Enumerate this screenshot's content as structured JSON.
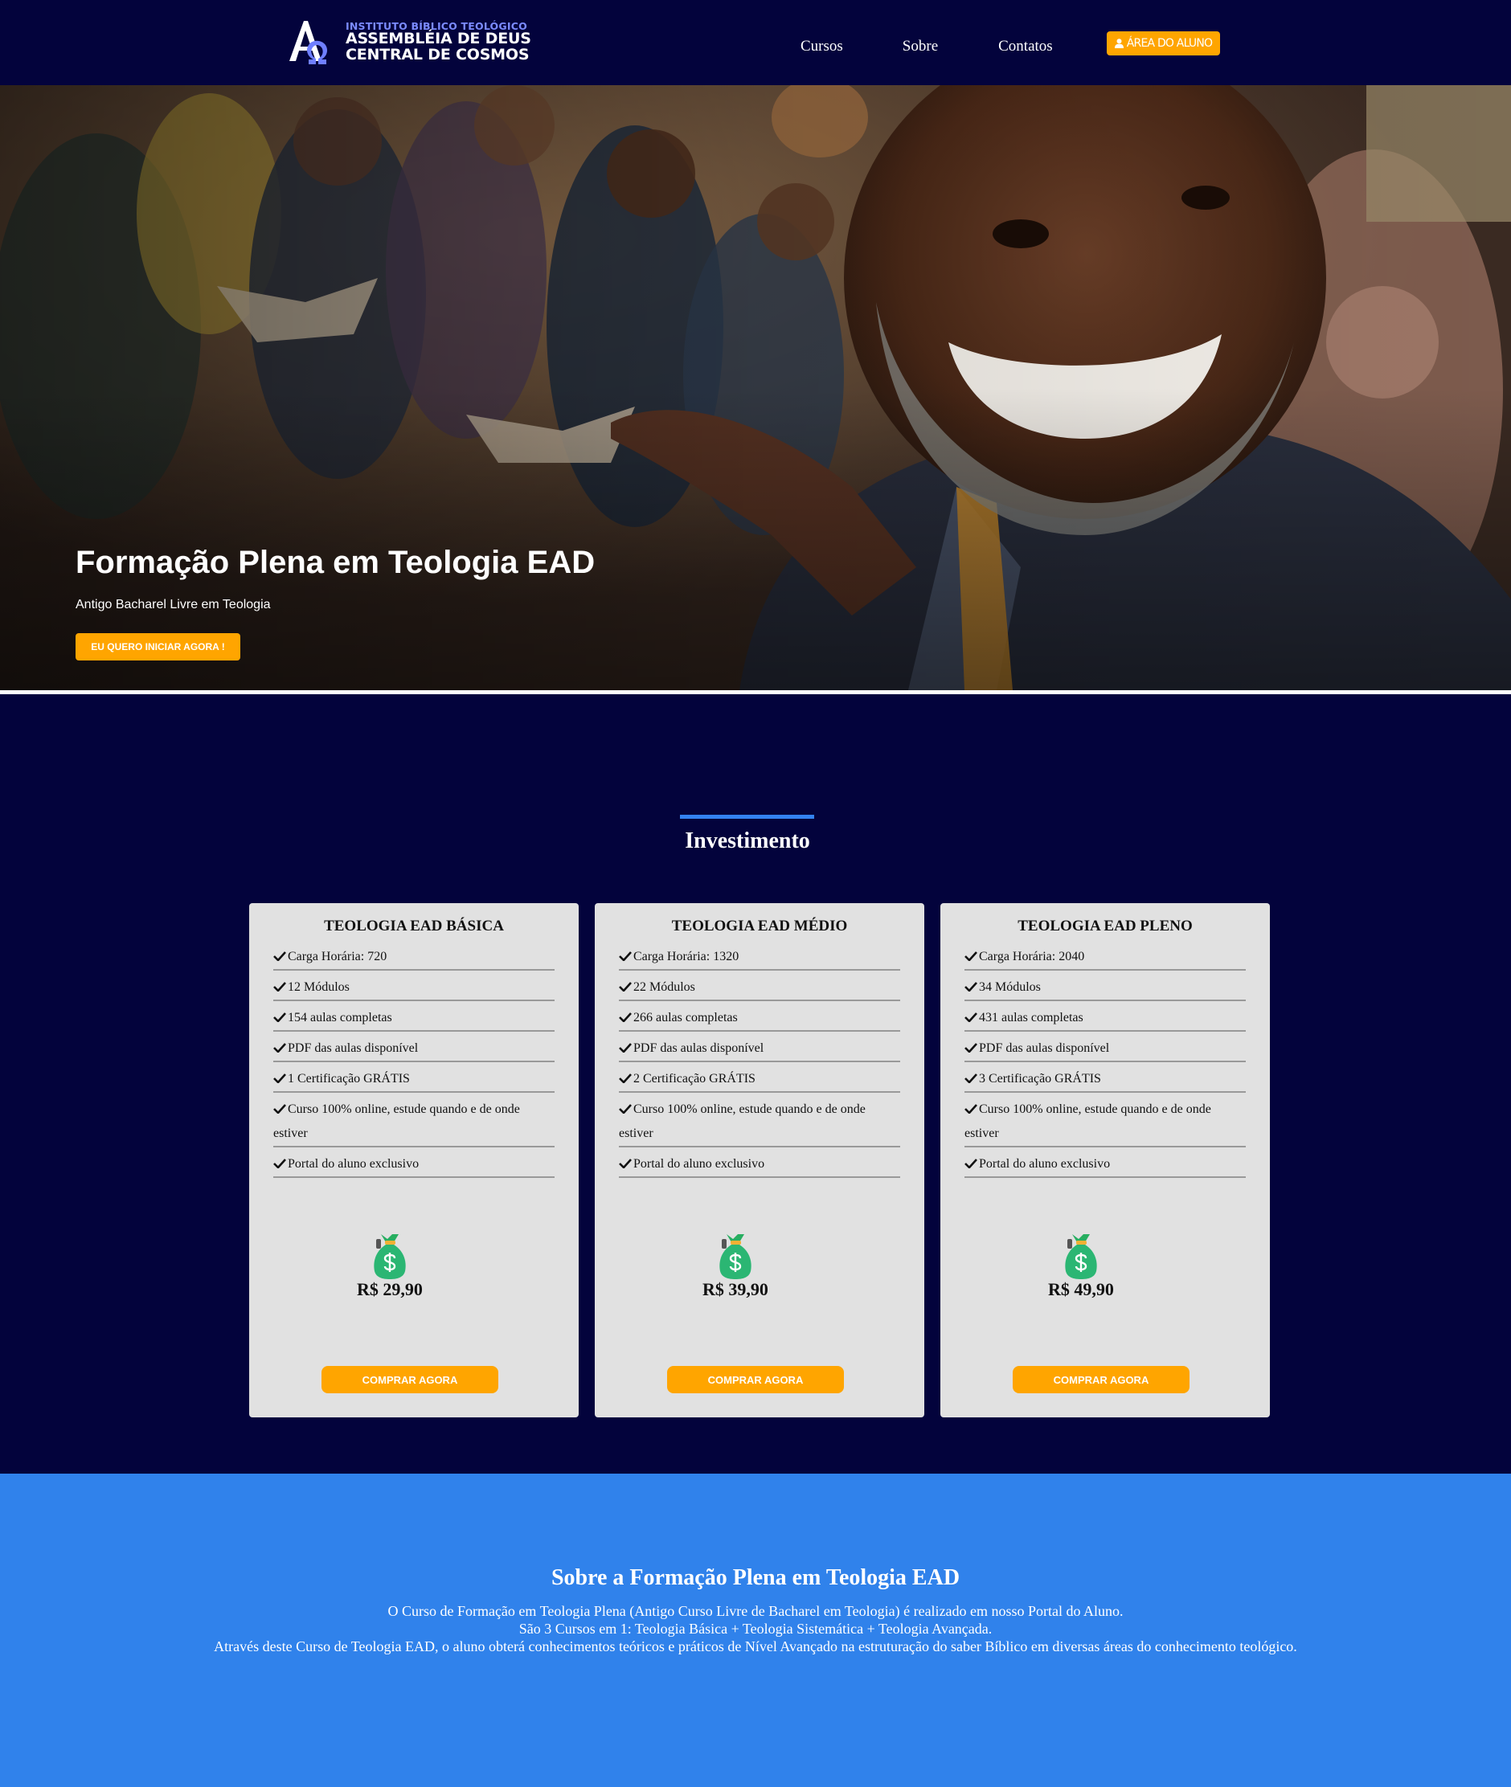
{
  "brand": {
    "line1": "INSTITUTO BÍBLICO TEOLÓGICO",
    "line2": "ASSEMBLÉIA DE DEUS",
    "line3": "CENTRAL DE COSMOS"
  },
  "nav": {
    "links": [
      "Cursos",
      "Sobre",
      "Contatos"
    ],
    "area_label": "ÁREA DO ALUNO"
  },
  "hero": {
    "title": "Formação Plena em Teologia EAD",
    "subtitle": "Antigo Bacharel Livre em Teologia",
    "cta": "EU QUERO INICIAR AGORA !"
  },
  "invest": {
    "title": "Investimento",
    "cards": [
      {
        "title": "TEOLOGIA EAD BÁSICA",
        "features": [
          "Carga Horária: 720",
          "12 Módulos",
          "154 aulas completas",
          "PDF das aulas disponível",
          "1 Certificação GRÁTIS",
          "Curso 100% online, estude quando e de onde estiver",
          "Portal do aluno exclusivo"
        ],
        "price": "R$ 29,90",
        "button": "COMPRAR AGORA"
      },
      {
        "title": "TEOLOGIA EAD MÉDIO",
        "features": [
          "Carga Horária: 1320",
          "22 Módulos",
          "266 aulas completas",
          "PDF das aulas disponível",
          "2 Certificação GRÁTIS",
          "Curso 100% online, estude quando e de onde estiver",
          "Portal do aluno exclusivo"
        ],
        "price": "R$ 39,90",
        "button": "COMPRAR AGORA"
      },
      {
        "title": "TEOLOGIA EAD PLENO",
        "features": [
          "Carga Horária: 2040",
          "34 Módulos",
          "431 aulas completas",
          "PDF das aulas disponível",
          "3 Certificação GRÁTIS",
          "Curso 100% online, estude quando e de onde estiver",
          "Portal do aluno exclusivo"
        ],
        "price": "R$ 49,90",
        "button": "COMPRAR AGORA"
      }
    ]
  },
  "sobre": {
    "title": "Sobre a Formação Plena em Teologia EAD",
    "paragraphs": [
      "O Curso de Formação em Teologia Plena (Antigo Curso Livre de Bacharel em Teologia) é realizado em nosso Portal do Aluno.",
      "São 3 Cursos em 1: Teologia Básica + Teologia Sistemática + Teologia Avançada.",
      "Através deste Curso de Teologia EAD, o aluno obterá conhecimentos teóricos e práticos de Nível Avançado na estruturação do saber Bíblico em diversas áreas do conhecimento teológico."
    ]
  },
  "colors": {
    "navy": "#03033c",
    "accent_orange": "#ffa500",
    "accent_blue": "#3082eb",
    "card_bg": "#e1e1e1"
  },
  "icons": [
    "user-icon",
    "check-icon",
    "money-bag-icon",
    "logo-alpha-omega-icon"
  ]
}
